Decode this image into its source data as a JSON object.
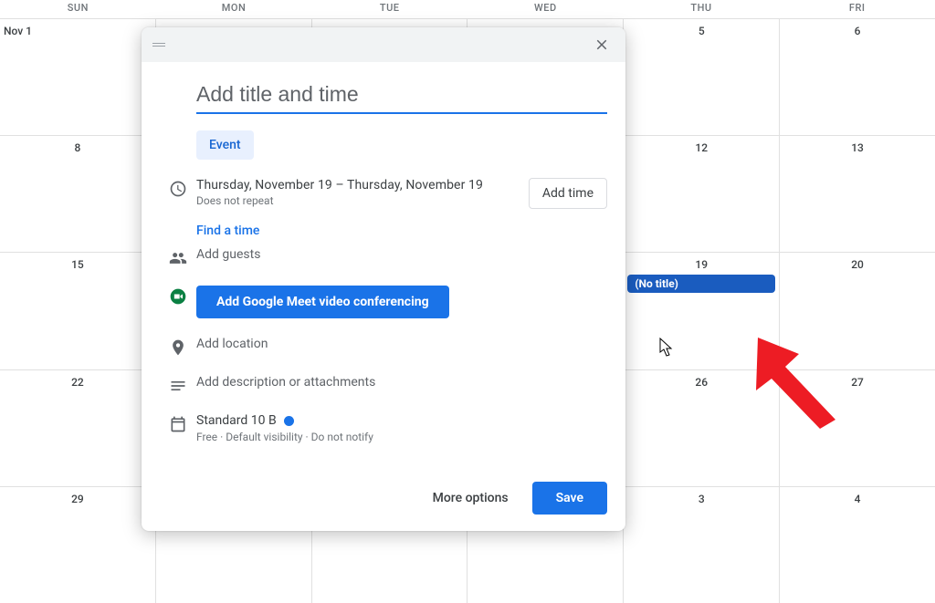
{
  "headers": [
    "SUN",
    "MON",
    "TUE",
    "WED",
    "THU",
    "FRI"
  ],
  "weeks": [
    [
      "Nov 1",
      "",
      "",
      "",
      "5",
      "6"
    ],
    [
      "8",
      "",
      "",
      "",
      "12",
      "13"
    ],
    [
      "15",
      "",
      "",
      "",
      "19",
      "20"
    ],
    [
      "22",
      "",
      "",
      "",
      "26",
      "27"
    ],
    [
      "29",
      "",
      "",
      "",
      "3",
      "4"
    ]
  ],
  "chip": {
    "row": 2,
    "col": 4,
    "label": "(No title)"
  },
  "modal": {
    "title_placeholder": "Add title and time",
    "type": "Event",
    "date_range": "Thursday, November 19  –  Thursday, November 19",
    "repeat": "Does not repeat",
    "add_time": "Add time",
    "find_time": "Find a time",
    "add_guests": "Add guests",
    "meet": "Add Google Meet video conferencing",
    "add_location": "Add location",
    "add_description": "Add description or attachments",
    "calendar_name": "Standard 10 B",
    "calendar_sub": "Free · Default visibility · Do not notify",
    "more_options": "More options",
    "save": "Save"
  }
}
